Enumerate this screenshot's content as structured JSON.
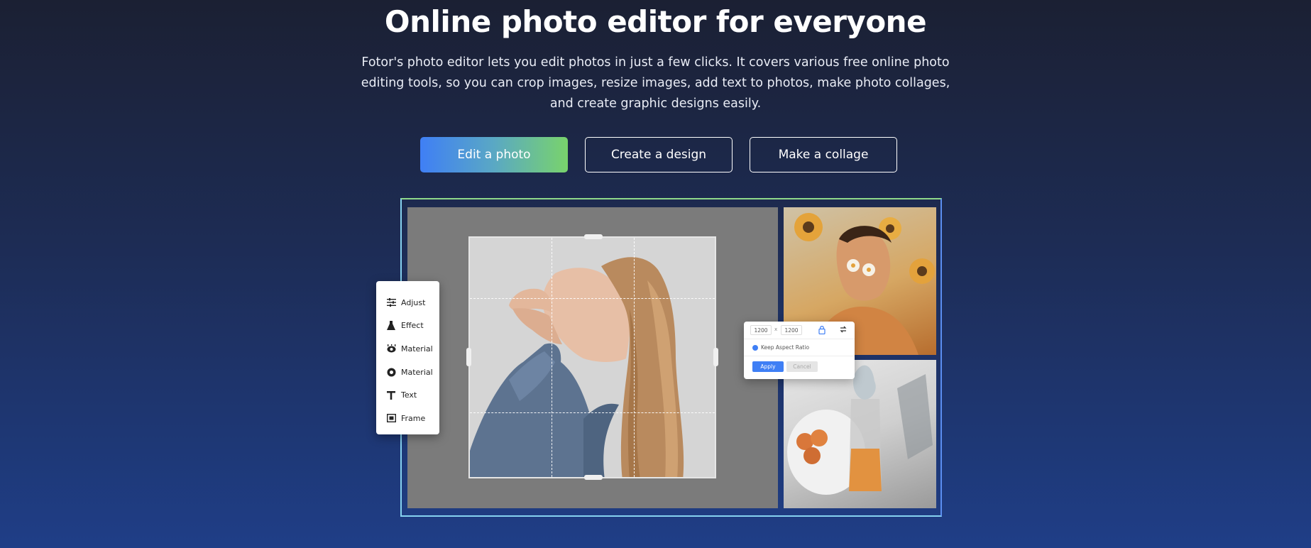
{
  "hero": {
    "title": "Online photo editor for everyone",
    "description": "Fotor's photo editor lets you edit photos in just a few clicks. It covers various free online photo editing tools, so you can crop images, resize images, add text to photos, make photo collages, and create graphic designs easily."
  },
  "cta": {
    "edit_label": "Edit a photo",
    "design_label": "Create a design",
    "collage_label": "Make a collage"
  },
  "tools_panel": {
    "items": [
      {
        "label": "Adjust",
        "icon": "sliders-icon"
      },
      {
        "label": "Effect",
        "icon": "flask-icon"
      },
      {
        "label": "Material",
        "icon": "eye-icon"
      },
      {
        "label": "Material",
        "icon": "circle-icon"
      },
      {
        "label": "Text",
        "icon": "text-t-icon"
      },
      {
        "label": "Frame",
        "icon": "frame-icon"
      }
    ]
  },
  "resize_popup": {
    "width_value": "1200",
    "separator": "x",
    "height_value": "1200",
    "keep_ratio_label": "Keep Aspect Ratio",
    "apply_label": "Apply",
    "cancel_label": "Cancel"
  },
  "colors": {
    "accent_blue": "#3f7ff5",
    "accent_green": "#79d36c",
    "background_top": "#1b2033",
    "background_bottom": "#1f3e87"
  }
}
